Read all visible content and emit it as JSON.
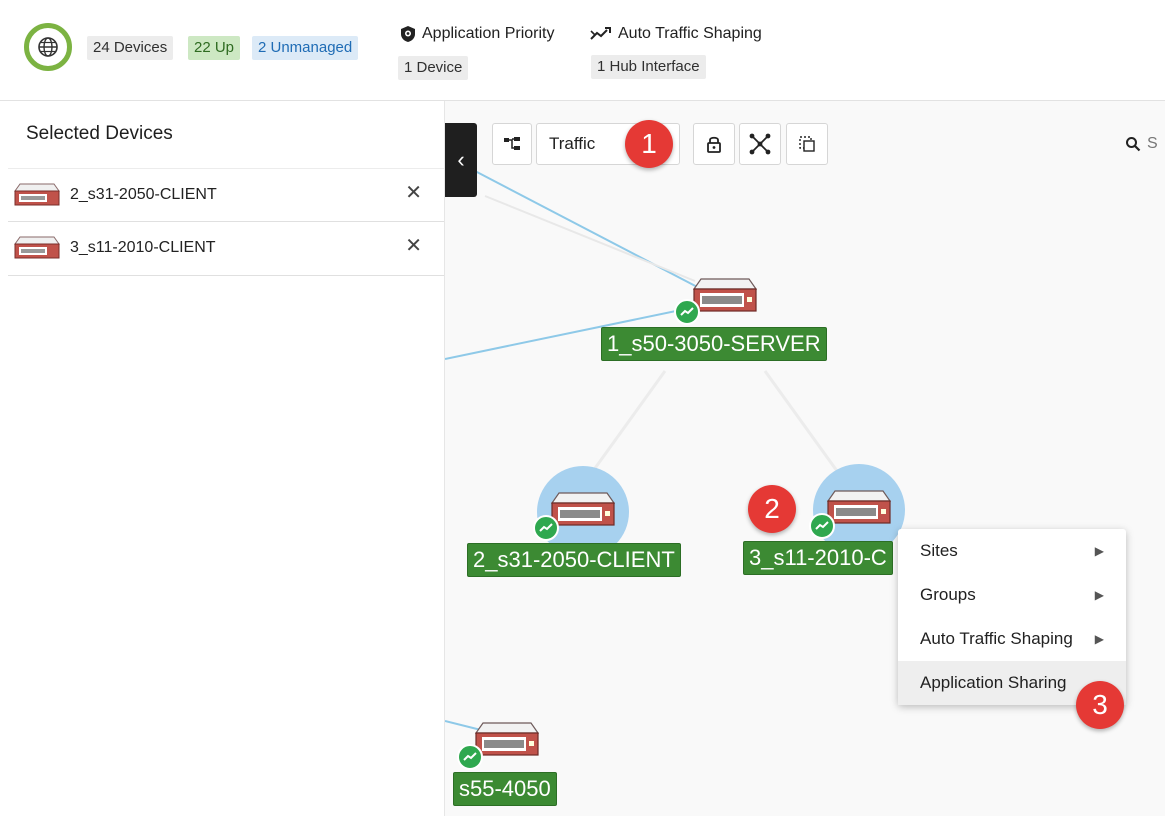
{
  "header": {
    "devices_label": "24 Devices",
    "up_label": "22 Up",
    "unmanaged_label": "2 Unmanaged",
    "app_priority_title": "Application Priority",
    "app_priority_count": "1 Device",
    "ats_title": "Auto Traffic Shaping",
    "ats_count": "1 Hub Interface"
  },
  "left_panel": {
    "title": "Selected Devices",
    "items": [
      {
        "label": "2_s31-2050-CLIENT",
        "remove": "✕"
      },
      {
        "label": "3_s11-2010-CLIENT",
        "remove": "✕"
      }
    ]
  },
  "toolbar": {
    "collapse": "‹",
    "view_select": "Traffic",
    "search_placeholder": "S"
  },
  "map": {
    "nodes": [
      {
        "label": "1_s50-3050-SERVER"
      },
      {
        "label": "2_s31-2050-CLIENT"
      },
      {
        "label": "3_s11-2010-C"
      },
      {
        "label": "s55-4050"
      }
    ]
  },
  "context_menu": {
    "items": [
      {
        "label": "Sites",
        "arrow": "▶"
      },
      {
        "label": "Groups",
        "arrow": "▶"
      },
      {
        "label": "Auto Traffic Shaping",
        "arrow": "▶"
      },
      {
        "label": "Application Sharing"
      }
    ]
  },
  "badges": [
    "1",
    "2",
    "3"
  ],
  "colors": {
    "status_ok": "#2fa84f",
    "node_label_bg": "#3c8a33",
    "badge": "#e53935",
    "globe_ring": "#7cb342",
    "link": "#8ec9e8"
  }
}
